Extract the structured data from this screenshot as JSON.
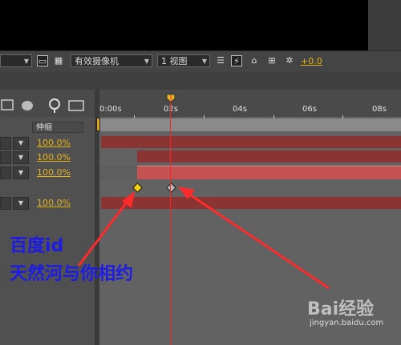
{
  "toolbar": {
    "camera_select": "有效摄像机",
    "view_select": "1 视图",
    "offset_value": "+0.0"
  },
  "ruler": {
    "ticks": [
      "0:00s",
      "02s",
      "04s",
      "06s",
      "08s"
    ]
  },
  "columns": {
    "stretch_header": "伸缩"
  },
  "layers": [
    {
      "stretch": "100.0%"
    },
    {
      "stretch": "100.0%"
    },
    {
      "stretch": "100.0%"
    },
    {
      "stretch": "100.0%"
    }
  ],
  "watermark": {
    "line1": "百度id",
    "line2": "天然河与你相约"
  },
  "logo": {
    "text": "Bai经验",
    "url": "jingyan.baidu.com"
  },
  "colors": {
    "accent": "#e3b21b",
    "layer_bar": "#8b3434",
    "layer_bar_selected": "#c55252",
    "playhead": "#ff2222",
    "annotation_arrow": "#ff2a2a",
    "watermark_text": "#1c1ce6"
  }
}
